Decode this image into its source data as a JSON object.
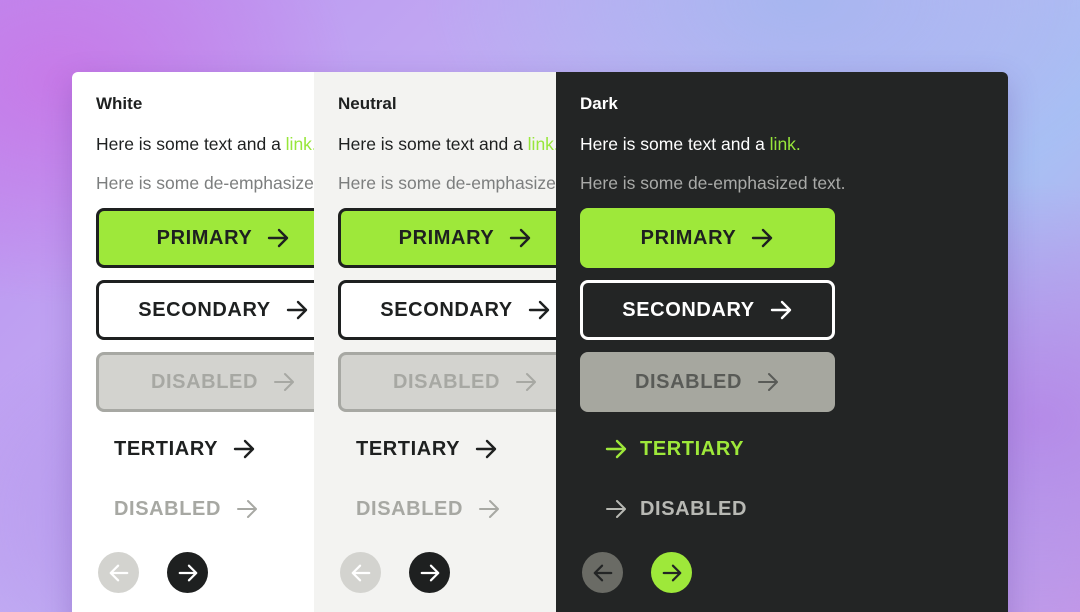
{
  "colors": {
    "accent_green": "#9ee83a",
    "ink": "#1e2020",
    "dark_bg": "#232525",
    "neutral_bg": "#f3f3f1",
    "disabled_fill": "#d3d3cf"
  },
  "panels": [
    {
      "title": "White",
      "body_text": "Here is some text and a ",
      "link_text": "link.",
      "deemphasized_text": "Here is some de-emphasized text.",
      "primary_label": "PRIMARY",
      "secondary_label": "SECONDARY",
      "disabled_label": "DISABLED",
      "tertiary_label": "TERTIARY",
      "text_disabled_label": "DISABLED"
    },
    {
      "title": "Neutral",
      "body_text": "Here is some text and a ",
      "link_text": "link.",
      "deemphasized_text": "Here is some de-emphasized text.",
      "primary_label": "PRIMARY",
      "secondary_label": "SECONDARY",
      "disabled_label": "DISABLED",
      "tertiary_label": "TERTIARY",
      "text_disabled_label": "DISABLED"
    },
    {
      "title": "Dark",
      "body_text": "Here is some text and a ",
      "link_text": "link.",
      "deemphasized_text": "Here is some de-emphasized text.",
      "primary_label": "PRIMARY",
      "secondary_label": "SECONDARY",
      "disabled_label": "DISABLED",
      "tertiary_label": "TERTIARY",
      "text_disabled_label": "DISABLED"
    }
  ],
  "icons": {
    "button_arrow": "arrow-right-icon",
    "prev": "arrow-left-icon",
    "next": "arrow-right-icon"
  }
}
